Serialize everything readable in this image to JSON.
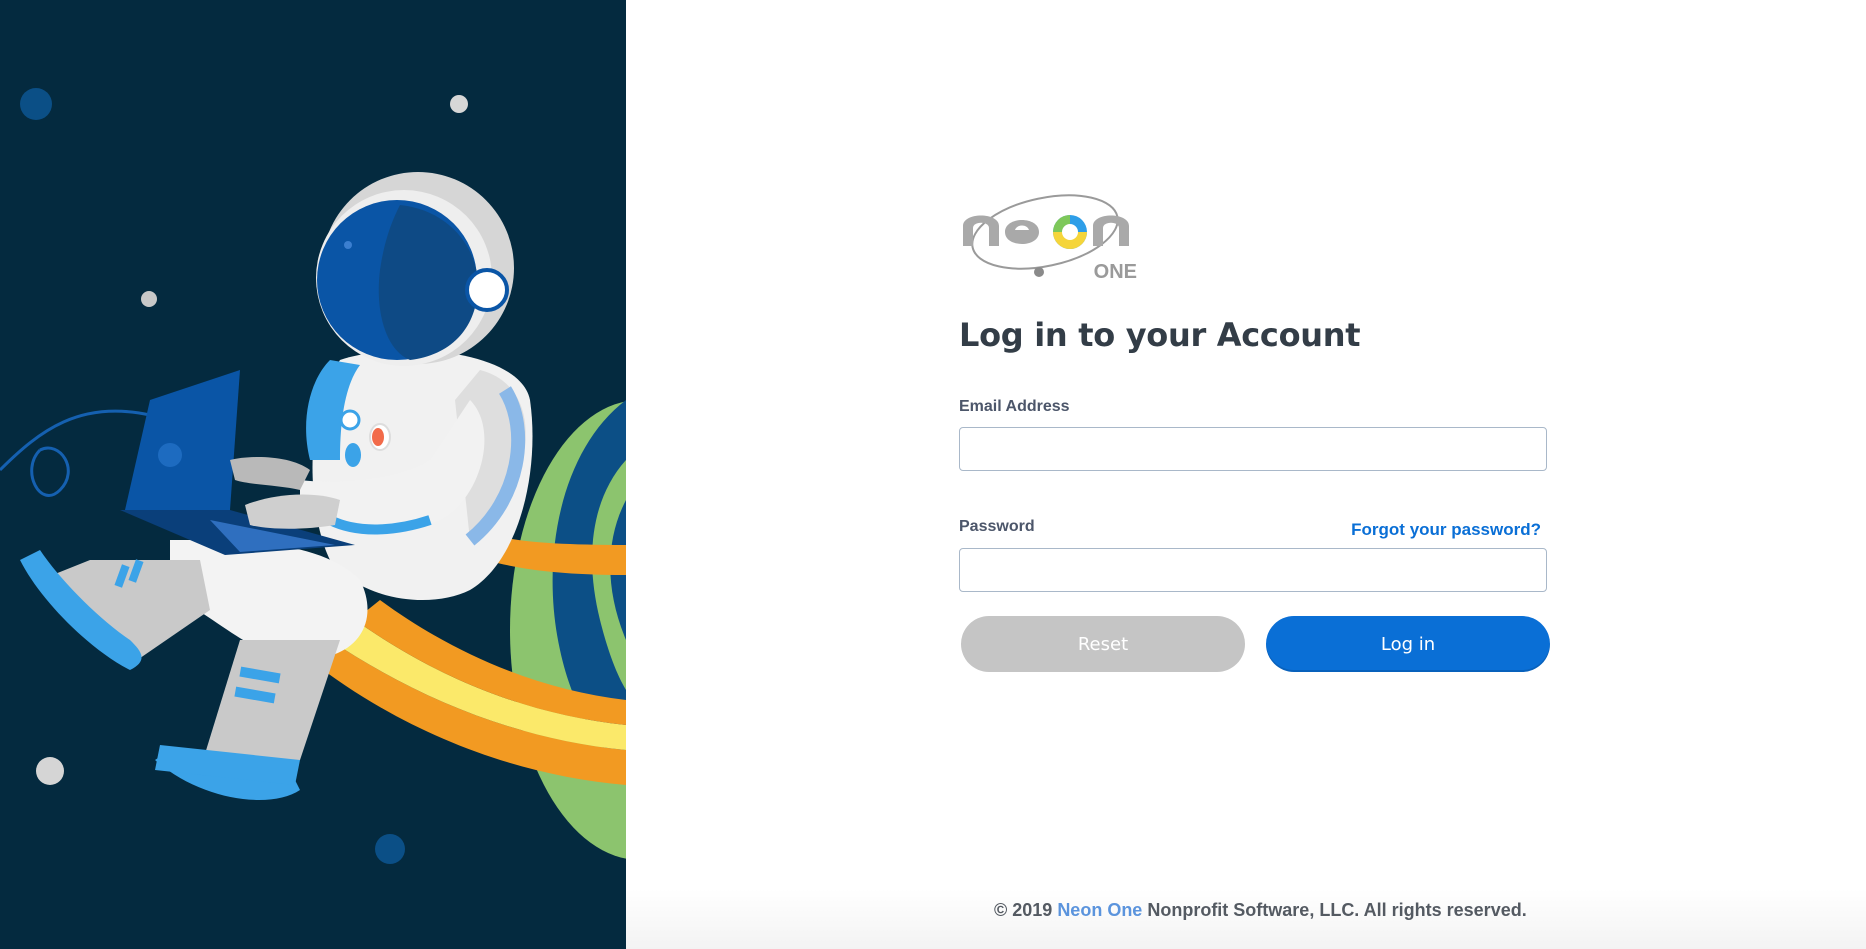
{
  "illustration": {
    "subject": "astronaut-with-laptop-on-planet-ring",
    "colors": {
      "background": "#042a3f",
      "helmet_visor": "#0a55a6",
      "suit": "#f2f2f2",
      "accent_blue": "#3ba3e8",
      "ring_orange": "#f29a22",
      "ring_yellow": "#fbe96a",
      "planet_green": "#8cc46e",
      "planet_blue": "#0c4f86"
    }
  },
  "brand": {
    "logo_word": "neon",
    "logo_sub": "ONE",
    "colors": {
      "logo_gray": "#a9a9a9",
      "logo_yellow": "#f5d53b",
      "logo_green": "#7ec85a",
      "logo_blue": "#2e9ee8"
    }
  },
  "form": {
    "title": "Log in to your Account",
    "email_label": "Email Address",
    "email_value": "",
    "password_label": "Password",
    "password_value": "",
    "forgot_link": "Forgot your password?",
    "reset_label": "Reset",
    "login_label": "Log in"
  },
  "footer": {
    "prefix": "© 2019 ",
    "brand": "Neon One",
    "suffix": " Nonprofit Software, LLC. All rights reserved."
  },
  "colors": {
    "primary": "#0a6fd6",
    "reset_gray": "#c5c5c5",
    "title_text": "#333d47",
    "footer_link": "#5b94dd"
  }
}
